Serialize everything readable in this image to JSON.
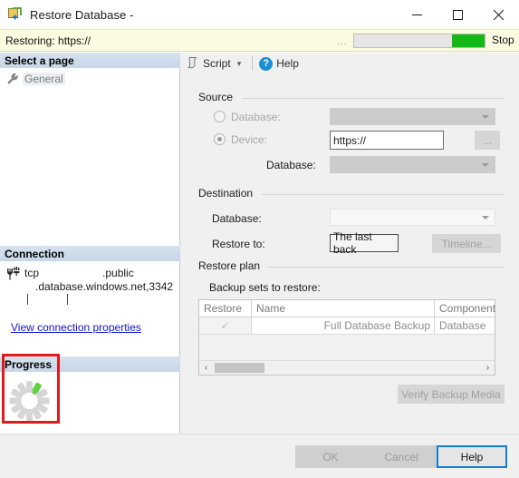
{
  "window": {
    "title": "Restore Database -",
    "icon": "restore-database-icon",
    "minimize": "minimize-icon",
    "maximize": "maximize-icon",
    "close": "close-icon"
  },
  "banner": {
    "status_text": "Restoring: https://",
    "overflow_dots": "...",
    "progress_percent": 75,
    "progress_color": "#16b816",
    "stop_label": "Stop"
  },
  "left_panel": {
    "select_page": {
      "header": "Select a page",
      "items": [
        {
          "label": "General",
          "icon": "wrench-icon"
        }
      ]
    },
    "connection": {
      "header": "Connection",
      "icon": "server-connection-icon",
      "line1": "tcp                     .public",
      "line2": ".database.windows.net,3342",
      "link_label": "View connection properties"
    },
    "progress": {
      "header": "Progress",
      "spinner": "loading-spinner-icon",
      "spinner_active_color": "#5ed13e",
      "highlight_color": "#e01b1b"
    }
  },
  "toolbar": {
    "script_label": "Script",
    "script_icon": "script-icon",
    "script_caret": "▾",
    "help_label": "Help",
    "help_icon": "help-icon",
    "help_glyph": "?"
  },
  "source": {
    "group_title": "Source",
    "database_radio_label": "Database:",
    "database_radio_checked": false,
    "database_combo_value": "",
    "device_radio_label": "Device:",
    "device_radio_checked": true,
    "device_value": "https://",
    "browse_label": "...",
    "database_label": "Database:",
    "source_database_combo_value": ""
  },
  "destination": {
    "group_title": "Destination",
    "database_label": "Database:",
    "database_value": "",
    "restore_to_label": "Restore to:",
    "restore_to_value": "The last back",
    "timeline_label": "Timeline..."
  },
  "restore_plan": {
    "group_title": "Restore plan",
    "sub_label": "Backup sets to restore:",
    "columns": [
      "Restore",
      "Name",
      "Component"
    ],
    "rows": [
      {
        "restore_checked": true,
        "name": "Full Database Backup",
        "component": "Database"
      }
    ],
    "scroll_left": "‹",
    "scroll_right": "›",
    "verify_label": "Verify Backup Media"
  },
  "footer": {
    "ok_label": "OK",
    "cancel_label": "Cancel",
    "help_label": "Help"
  }
}
